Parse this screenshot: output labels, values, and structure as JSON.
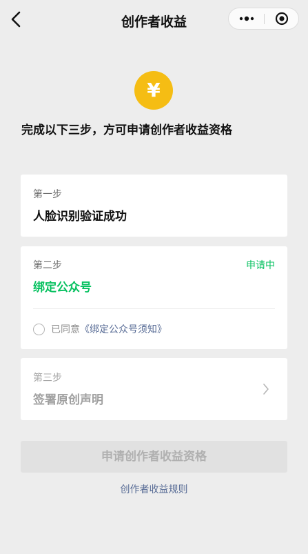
{
  "nav": {
    "title": "创作者收益",
    "icons": {
      "back": "back-arrow-icon",
      "more": "more-dots-icon",
      "close": "close-target-icon"
    }
  },
  "hero": {
    "coin_symbol": "¥",
    "headline": "完成以下三步，方可申请创作者收益资格"
  },
  "steps": [
    {
      "label": "第一步",
      "title": "人脸识别验证成功"
    },
    {
      "label": "第二步",
      "title": "绑定公众号",
      "status": "申请中",
      "agree_prefix": "已同意",
      "agree_link": "《绑定公众号须知》",
      "agreed": false
    },
    {
      "label": "第三步",
      "title": "签署原创声明"
    }
  ],
  "apply_button": "申请创作者收益资格",
  "rules_link": "创作者收益规则",
  "colors": {
    "accent_green": "#07c160",
    "link_blue": "#576b95",
    "coin_yellow": "#f5bd14",
    "background": "#ededed"
  }
}
